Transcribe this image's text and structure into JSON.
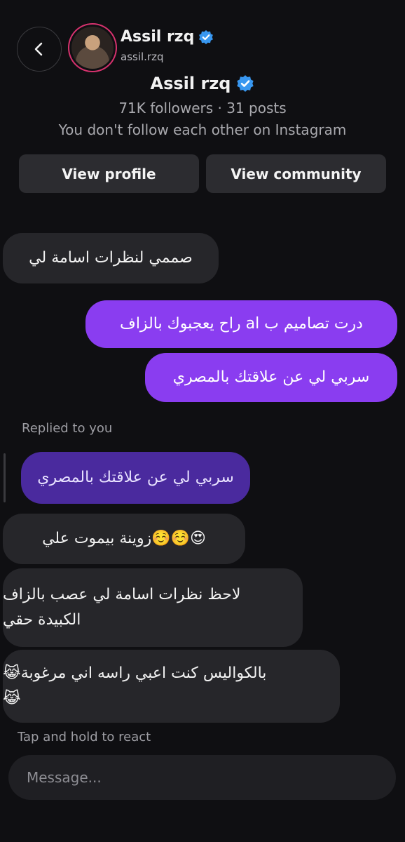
{
  "header": {
    "name": "Assil rzq",
    "username": "assil.rzq"
  },
  "profile": {
    "name": "Assil rzq",
    "stats": "71K followers · 31 posts",
    "follow_status": "You don't follow each other on Instagram",
    "view_profile_label": "View profile",
    "view_community_label": "View community"
  },
  "messages": {
    "m1": "صممي لنظرات اسامة لي",
    "m2": "درت تصاميم ب al راح يعجبوك بالزاف",
    "m3": "سربي لي عن علاقتك بالمصري",
    "replied_label": "Replied to you",
    "reply_quote": "سربي لي عن علاقتك بالمصري",
    "m4": "😍☺️☺️زوينة بيموت علي",
    "m5_line1": "لاحظ نظرات اسامة لي عصب بالزاف",
    "m5_line2": "الكبيدة حقي",
    "m6_line1": "بالكواليس كنت اعبي راسه اني مرغوبة😹",
    "m6_line2": "😹"
  },
  "footer": {
    "react_hint": "Tap and hold to react",
    "message_placeholder": "Message..."
  },
  "colors": {
    "background": "#0f0f12",
    "incoming_bubble": "#26262a",
    "outgoing_bubble": "#8a3df0",
    "verified": "#3897f0"
  }
}
